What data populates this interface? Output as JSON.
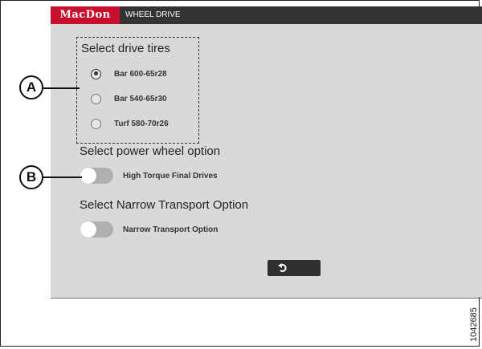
{
  "header": {
    "logo_text": "MacDon",
    "title": "WHEEL DRIVE",
    "brand_color": "#c8102e"
  },
  "drive_tires": {
    "heading": "Select drive tires",
    "options": [
      {
        "label": "Bar 600-65r28",
        "selected": true
      },
      {
        "label": "Bar 540-65r30",
        "selected": false
      },
      {
        "label": "Turf 580-70r26",
        "selected": false
      }
    ]
  },
  "power_wheel": {
    "heading": "Select power wheel option",
    "toggle_label": "High Torque Final Drives",
    "toggle_on": false
  },
  "narrow_transport": {
    "heading": "Select Narrow Transport Option",
    "toggle_label": "Narrow Transport Option",
    "toggle_on": false
  },
  "footer": {
    "back_icon": "back-arrow-icon"
  },
  "callouts": {
    "a": "A",
    "b": "B"
  },
  "figure_number": "1042685"
}
